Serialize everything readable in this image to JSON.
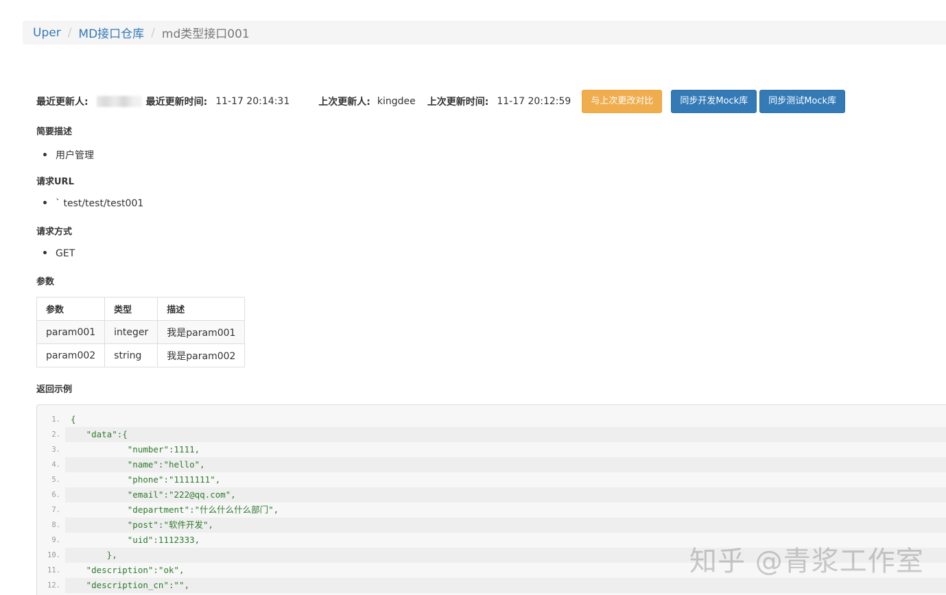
{
  "breadcrumb": {
    "items": [
      "Uper",
      "MD接口仓库"
    ],
    "current": "md类型接口001",
    "separator": "/"
  },
  "meta": {
    "latest_updater_label": "最近更新人:",
    "latest_update_time_label": "最近更新时间:",
    "latest_update_time": "11-17 20:14:31",
    "previous_updater_label": "上次更新人:",
    "previous_updater": "kingdee",
    "previous_update_time_label": "上次更新时间:",
    "previous_update_time": "11-17 20:12:59"
  },
  "buttons": {
    "compare": "与上次更改对比",
    "sync_dev": "同步开发Mock库",
    "sync_test": "同步测试Mock库"
  },
  "sections": {
    "summary_title": "简要描述",
    "summary_item": "用户管理",
    "url_title": "请求URL",
    "url_item": "` test/test/test001",
    "method_title": "请求方式",
    "method_item": "GET",
    "params_title": "参数",
    "response_title": "返回示例"
  },
  "params_table": {
    "headers": [
      "参数",
      "类型",
      "描述"
    ],
    "rows": [
      [
        "param001",
        "integer",
        "我是param001"
      ],
      [
        "param002",
        "string",
        "我是param002"
      ]
    ]
  },
  "code": {
    "line_numbers": [
      "1.",
      "2.",
      "3.",
      "4.",
      "5.",
      "6.",
      "7.",
      "8.",
      "9.",
      "10.",
      "11.",
      "12."
    ],
    "lines": [
      "{",
      "   \"data\":{",
      "           \"number\":1111,",
      "           \"name\":\"hello\",",
      "           \"phone\":\"1111111\",",
      "           \"email\":\"222@qq.com\",",
      "           \"department\":\"什么什么什么部门\",",
      "           \"post\":\"软件开发\",",
      "           \"uid\":1112333,",
      "       },",
      "   \"description\":\"ok\",",
      "   \"description_cn\":\"\","
    ]
  },
  "watermark": "知乎 @青浆工作室",
  "colors": {
    "link": "#337ab7",
    "warning_button": "#f0ad4e",
    "primary_button": "#337ab7",
    "code_text": "#2f7a2f"
  }
}
